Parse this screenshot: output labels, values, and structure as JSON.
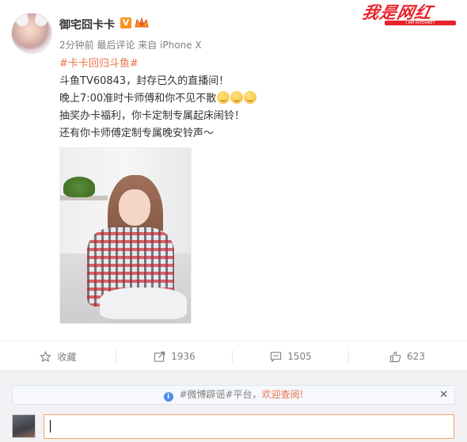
{
  "post": {
    "username": "御宅囧卡卡",
    "badge_v": "V",
    "meta": "2分钟前 最后评论 来自 iPhone X",
    "topic": "#卡卡回归斗鱼#",
    "lines": [
      "斗鱼TV60843，封存已久的直播间！",
      "晚上7:00准时卡师傅和你不见不散",
      "抽奖办卡福利，你卡定制专属起床闹铃！",
      "还有你卡师傅定制专属晚安铃声～"
    ],
    "emoji_count": 3,
    "emoji_name": "kiss-emoji-icon"
  },
  "watermark": {
    "text": "我是网红",
    "sub": "I AM INTERNET"
  },
  "actions": {
    "favorite": "收藏",
    "repost": "1936",
    "comment": "1505",
    "like": "623"
  },
  "comment_box": {
    "notice_pre": "#微博辟谣#平台，",
    "notice_link": "欢迎查阅",
    "notice_mark": "!",
    "close": "✕",
    "input_value": ""
  },
  "colors": {
    "accent": "#eb7350",
    "badge": "#f7931e",
    "watermark": "#e6242b",
    "input_border": "#f4a460"
  }
}
